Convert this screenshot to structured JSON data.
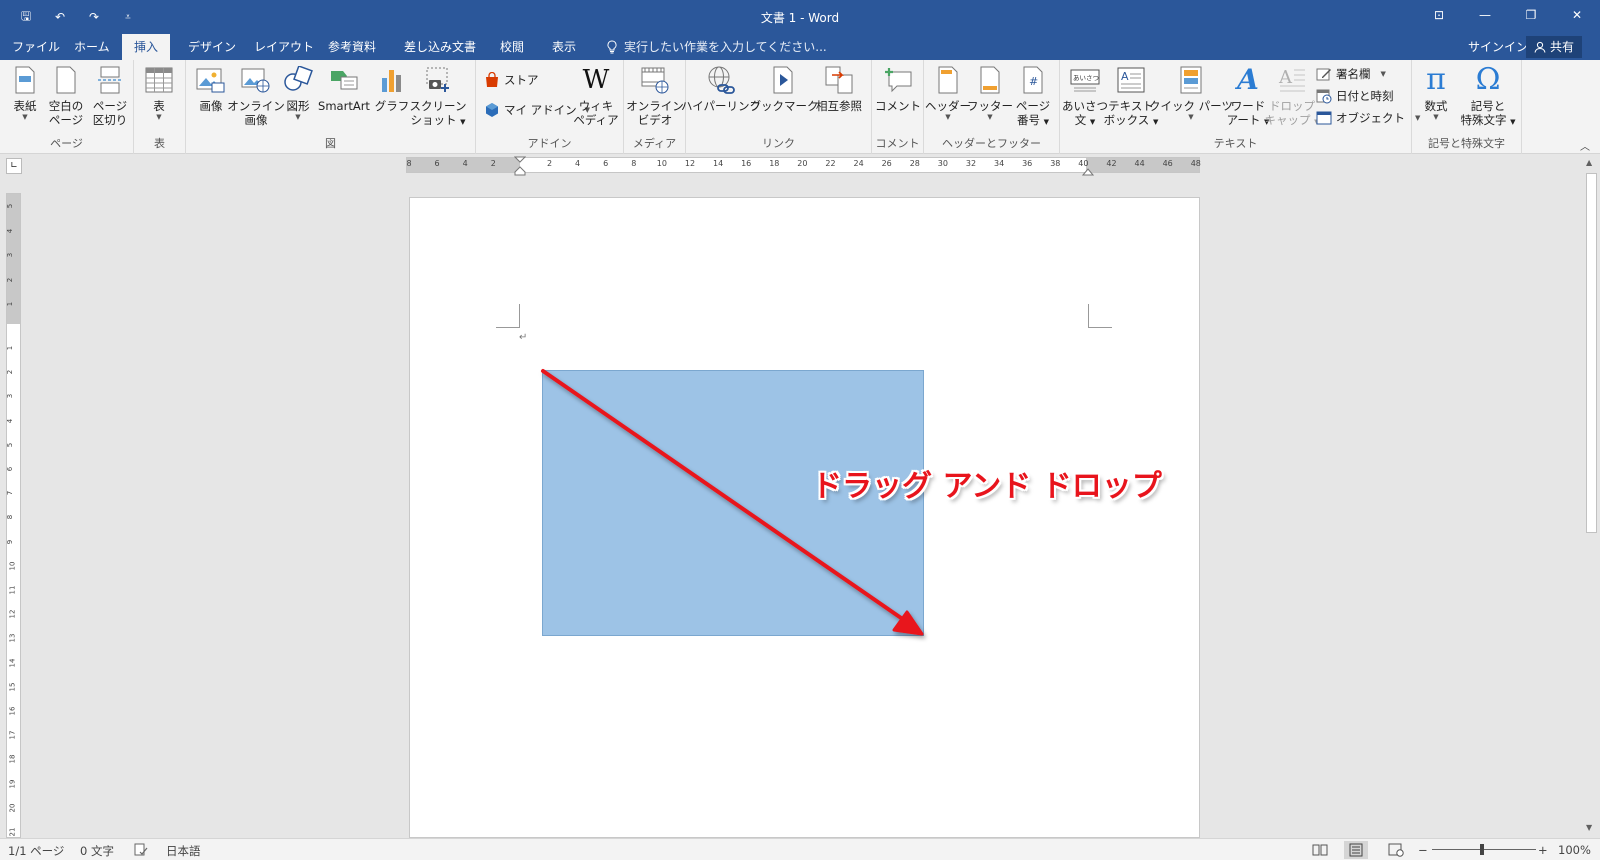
{
  "window": {
    "title": "文書 1 - Word",
    "quick_access": [
      {
        "name": "save-icon",
        "glyph": "🖫"
      },
      {
        "name": "undo-icon",
        "glyph": "↶"
      },
      {
        "name": "redo-icon",
        "glyph": "↷"
      },
      {
        "name": "customize-qat-icon",
        "glyph": "⩡"
      }
    ],
    "controls": {
      "ribbon_options": "⊡",
      "minimize": "—",
      "restore": "❐",
      "close": "✕"
    }
  },
  "tabs": [
    "ファイル",
    "ホーム",
    "挿入",
    "デザイン",
    "レイアウト",
    "参考資料",
    "差し込み文書",
    "校閲",
    "表示"
  ],
  "active_tab": "挿入",
  "tell_me": "実行したい作業を入力してください...",
  "signin": "サインイン",
  "share": "共有",
  "ribbon": {
    "groups": {
      "pages": "ページ",
      "tables": "表",
      "illustrations": "図",
      "addins": "アドイン",
      "media": "メディア",
      "links": "リンク",
      "comments": "コメント",
      "header_footer": "ヘッダーとフッター",
      "text": "テキスト",
      "symbols": "記号と特殊文字"
    },
    "buttons": {
      "cover_page": "表紙",
      "blank_page_1": "空白の",
      "blank_page_2": "ページ",
      "page_break_1": "ページ",
      "page_break_2": "区切り",
      "table": "表",
      "pictures": "画像",
      "online_pictures_1": "オンライン",
      "online_pictures_2": "画像",
      "shapes": "図形",
      "smartart": "SmartArt",
      "chart": "グラフ",
      "screenshot_1": "スクリーン",
      "screenshot_2": "ショット",
      "store": "ストア",
      "my_addins": "マイ アドイン",
      "wikipedia_1": "ウィキ",
      "wikipedia_2": "ペディア",
      "online_video_1": "オンライン",
      "online_video_2": "ビデオ",
      "hyperlink": "ハイパーリンク",
      "bookmark": "ブックマーク",
      "cross_reference": "相互参照",
      "comment": "コメント",
      "header": "ヘッダー",
      "footer": "フッター",
      "page_number_1": "ページ",
      "page_number_2": "番号",
      "greeting_1": "あいさつ",
      "greeting_2": "文",
      "text_box_1": "テキスト",
      "text_box_2": "ボックス",
      "quick_parts": "クイック パーツ",
      "wordart_1": "ワード",
      "wordart_2": "アート",
      "drop_cap_1": "ドロップ",
      "drop_cap_2": "キャップ",
      "signature_line": "署名欄",
      "date_time": "日付と時刻",
      "object": "オブジェクト",
      "equation": "数式",
      "symbol_1": "記号と",
      "symbol_2": "特殊文字"
    }
  },
  "ruler": {
    "h_ticks": [
      "8",
      "6",
      "4",
      "2",
      "2",
      "4",
      "6",
      "8",
      "10",
      "12",
      "14",
      "16",
      "18",
      "20",
      "22",
      "24",
      "26",
      "28",
      "30",
      "32",
      "34",
      "36",
      "38",
      "40",
      "42",
      "44",
      "46",
      "48"
    ],
    "v_ticks": [
      "5",
      "4",
      "3",
      "2",
      "1",
      "1",
      "2",
      "3",
      "4",
      "5",
      "6",
      "7",
      "8",
      "9",
      "10",
      "11",
      "12",
      "13",
      "14",
      "15",
      "16",
      "17",
      "18",
      "19",
      "20",
      "21"
    ]
  },
  "document": {
    "paragraph_mark": "↵",
    "annotation": "ドラッグ アンド ドロップ",
    "shape_fill": "#9dc3e6",
    "arrow_color": "#e8141c"
  },
  "status": {
    "page": "1/1 ページ",
    "words": "0 文字",
    "language": "日本語",
    "zoom": "100%",
    "zoom_minus": "−",
    "zoom_plus": "+"
  },
  "colors": {
    "accent": "#2b579a"
  }
}
